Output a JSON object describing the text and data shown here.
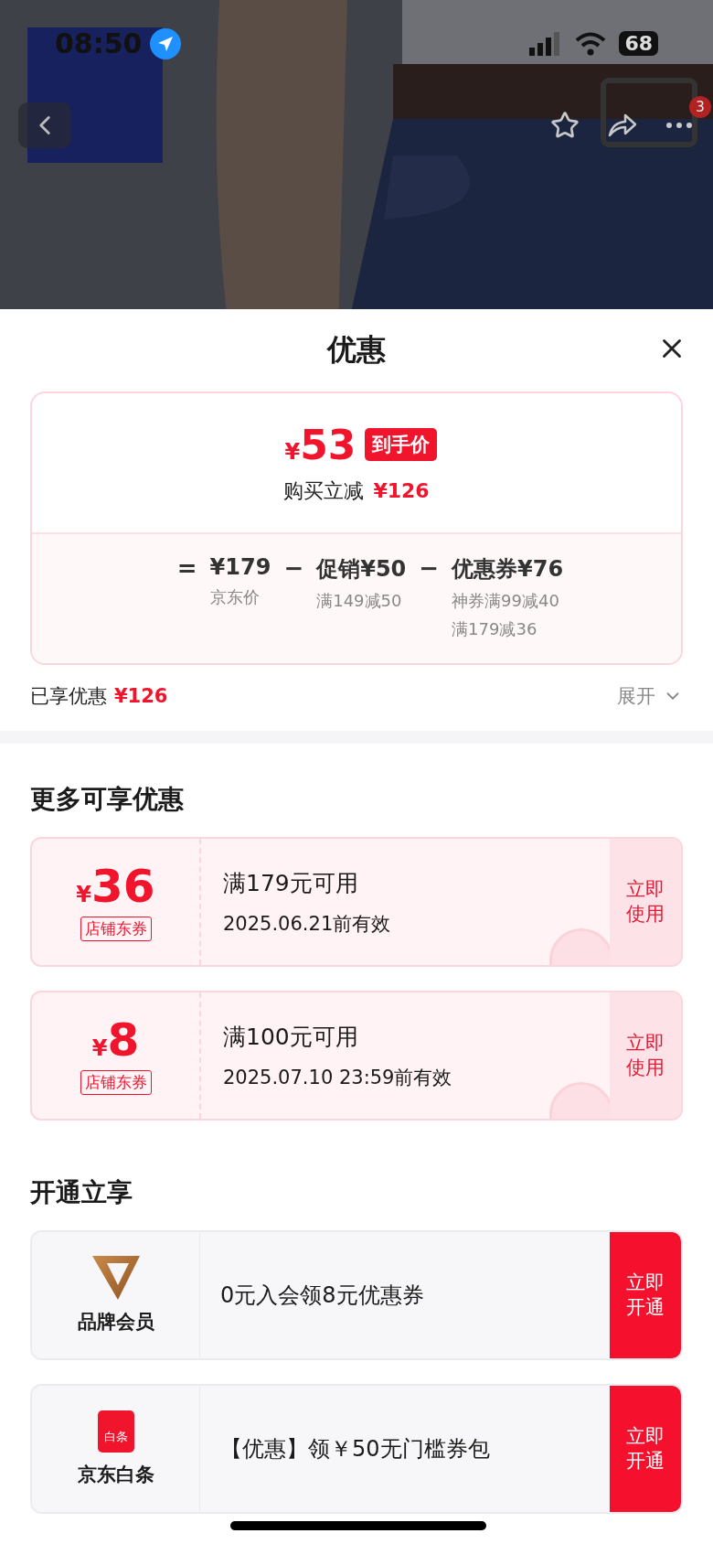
{
  "status_bar": {
    "time": "08:50",
    "battery": "68"
  },
  "nav": {
    "badge": "3"
  },
  "sheet": {
    "title": "优惠"
  },
  "price": {
    "currency": "¥",
    "final": "53",
    "final_tag": "到手价",
    "saving_label": "购买立减",
    "saving_amount": "¥126",
    "terms": [
      {
        "operator": "=",
        "value": "¥179",
        "notes": [
          "京东价"
        ]
      },
      {
        "operator": "−",
        "value": "促销¥50",
        "notes": [
          "满149减50"
        ]
      },
      {
        "operator": "−",
        "value": "优惠券¥76",
        "notes": [
          "神券满99减40",
          "满179减36"
        ]
      }
    ]
  },
  "enjoyed": {
    "label": "已享优惠",
    "amount": "¥126",
    "expand": "展开"
  },
  "more": {
    "title": "更多可享优惠",
    "coupons": [
      {
        "currency": "¥",
        "amount": "36",
        "tag": "店铺东券",
        "condition": "满179元可用",
        "validity": "2025.06.21前有效",
        "action": "立即使用"
      },
      {
        "currency": "¥",
        "amount": "8",
        "tag": "店铺东券",
        "condition": "满100元可用",
        "validity": "2025.07.10 23:59前有效",
        "action": "立即使用"
      }
    ]
  },
  "open": {
    "title": "开通立享",
    "offers": [
      {
        "kind": "member",
        "name": "品牌会员",
        "text": "0元入会领8元优惠券",
        "action": "立即开通"
      },
      {
        "kind": "baitiao",
        "name": "京东白条",
        "icon_label": "白条",
        "text": "【优惠】领￥50无门槛券包",
        "action": "立即开通"
      }
    ]
  }
}
